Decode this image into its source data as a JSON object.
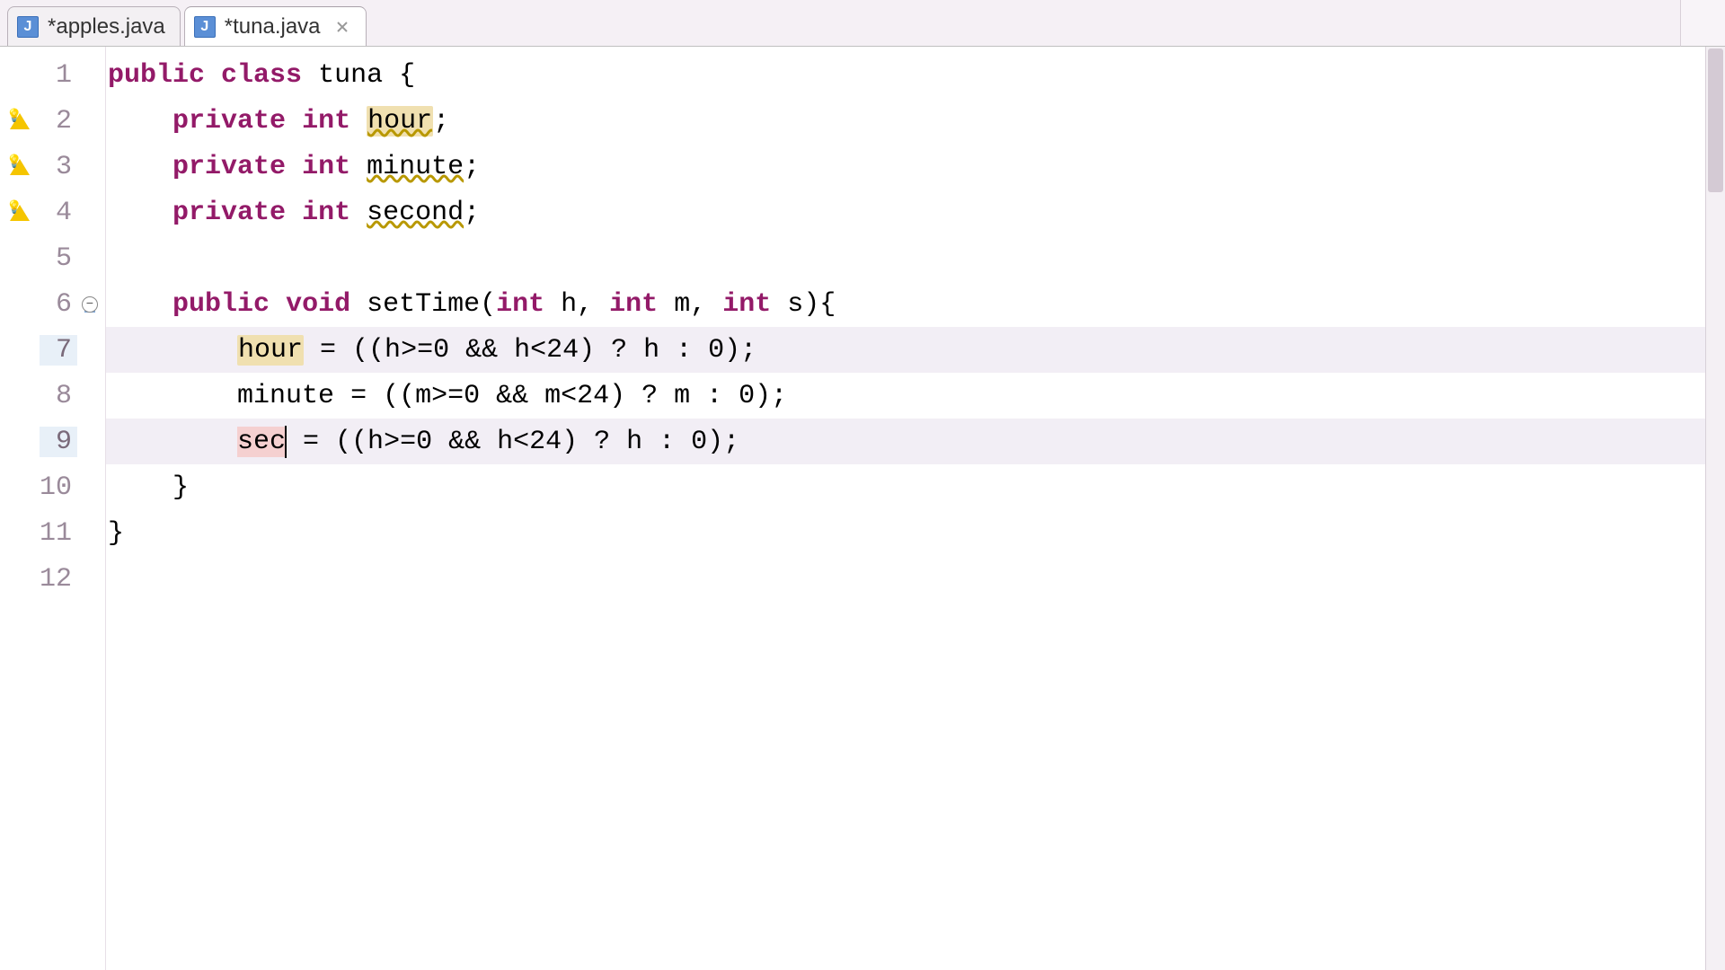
{
  "tabs": [
    {
      "label": "*apples.java",
      "iconLetter": "J",
      "active": false,
      "closeVisible": false
    },
    {
      "label": "*tuna.java",
      "iconLetter": "J",
      "active": true,
      "closeVisible": true
    }
  ],
  "gutter": {
    "rows": [
      {
        "n": "1",
        "warn": false,
        "hl": false,
        "fold": "none"
      },
      {
        "n": "2",
        "warn": true,
        "hl": false,
        "fold": "none"
      },
      {
        "n": "3",
        "warn": true,
        "hl": false,
        "fold": "none"
      },
      {
        "n": "4",
        "warn": true,
        "hl": false,
        "fold": "none"
      },
      {
        "n": "5",
        "warn": false,
        "hl": false,
        "fold": "none"
      },
      {
        "n": "6",
        "warn": false,
        "hl": false,
        "fold": "start"
      },
      {
        "n": "7",
        "warn": false,
        "hl": true,
        "fold": "mid"
      },
      {
        "n": "8",
        "warn": false,
        "hl": false,
        "fold": "mid"
      },
      {
        "n": "9",
        "warn": false,
        "hl": true,
        "fold": "mid"
      },
      {
        "n": "10",
        "warn": false,
        "hl": false,
        "fold": "end"
      },
      {
        "n": "11",
        "warn": false,
        "hl": false,
        "fold": "none"
      },
      {
        "n": "12",
        "warn": false,
        "hl": false,
        "fold": "none"
      }
    ]
  },
  "code": {
    "l1": {
      "kw1": "public",
      "kw2": "class",
      "name": "tuna",
      "rest": " {"
    },
    "l2": {
      "indent": "    ",
      "kw1": "private",
      "typ": "int",
      "sp": " ",
      "field": "hour",
      "rest": ";"
    },
    "l3": {
      "indent": "    ",
      "kw1": "private",
      "typ": "int",
      "sp": " ",
      "field": "minute",
      "rest": ";"
    },
    "l4": {
      "indent": "    ",
      "kw1": "private",
      "typ": "int",
      "sp": " ",
      "field": "second",
      "rest": ";"
    },
    "l5": "",
    "l6": {
      "indent": "    ",
      "kw1": "public",
      "kw2": "void",
      "name": "setTime",
      "params": "(",
      "t": "int",
      "p1": " h, ",
      "p2": " m, ",
      "p3": " s){"
    },
    "l7": {
      "indent": "        ",
      "field": "hour",
      "rest": " = ((h>=0 && h<24) ? h : 0);"
    },
    "l8": {
      "indent": "        ",
      "field": "minute",
      "rest": " = ((m>=0 && m<24) ? m : 0);"
    },
    "l9": {
      "indent": "        ",
      "field": "sec",
      "rest": " = ((h>=0 && h<24) ? h : 0);"
    },
    "l10": {
      "indent": "    ",
      "rest": "}"
    },
    "l11": {
      "rest": "}"
    },
    "l12": ""
  }
}
